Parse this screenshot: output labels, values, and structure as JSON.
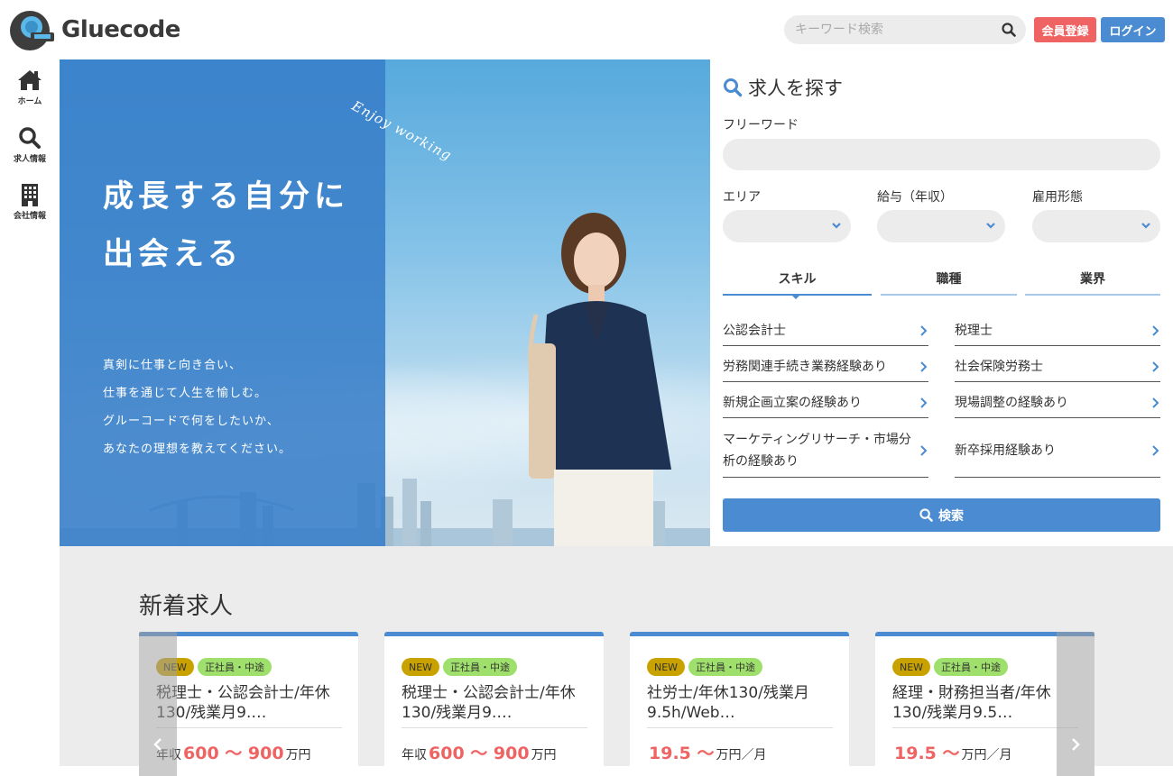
{
  "header": {
    "logo_text": "Gluecode",
    "search_placeholder": "キーワード検索",
    "register_label": "会員登録",
    "login_label": "ログイン"
  },
  "sidenav": [
    {
      "label": "ホーム",
      "icon": "home-icon"
    },
    {
      "label": "求人情報",
      "icon": "search-icon"
    },
    {
      "label": "会社情報",
      "icon": "building-icon"
    }
  ],
  "hero": {
    "title_line1": "成長する自分に",
    "title_line2": "出会える",
    "tagline": "Enjoy working",
    "sub_lines": [
      "真剣に仕事と向き合い、",
      "仕事を通じて人生を愉しむ。",
      "グルーコードで何をしたいか、",
      "あなたの理想を教えてください。"
    ]
  },
  "search_panel": {
    "title": "求人を探す",
    "freeword_label": "フリーワード",
    "area_label": "エリア",
    "salary_label": "給与（年収）",
    "employment_label": "雇用形態",
    "tabs": [
      "スキル",
      "職種",
      "業界"
    ],
    "skills": [
      "公認会計士",
      "税理士",
      "労務関連手続き業務経験あり",
      "社会保険労務士",
      "新規企画立案の経験あり",
      "現場調整の経験あり",
      "マーケティングリサーチ・市場分析の経験あり",
      "新卒採用経験あり"
    ],
    "submit_label": "検索"
  },
  "new_jobs": {
    "title": "新着求人",
    "cards": [
      {
        "badge_new": "NEW",
        "badge_type": "正社員・中途",
        "title": "税理士・公認会計士/年休130/残業月9.…",
        "prefix": "年収",
        "range": "600 〜 900",
        "unit": "万円"
      },
      {
        "badge_new": "NEW",
        "badge_type": "正社員・中途",
        "title": "税理士・公認会計士/年休130/残業月9.…",
        "prefix": "年収",
        "range": "600 〜 900",
        "unit": "万円"
      },
      {
        "badge_new": "NEW",
        "badge_type": "正社員・中途",
        "title": "社労士/年休130/残業月9.5h/Web…",
        "prefix": "",
        "range": "19.5 〜",
        "unit": "万円／月"
      },
      {
        "badge_new": "NEW",
        "badge_type": "正社員・中途",
        "title": "経理・財務担当者/年休130/残業月9.5…",
        "prefix": "",
        "range": "19.5 〜",
        "unit": "万円／月"
      }
    ]
  },
  "colors": {
    "accent": "#4a8bd1",
    "register": "#f06363",
    "badge_new": "#c9a200",
    "badge_type": "#9ee06b",
    "salary": "#f06363"
  }
}
